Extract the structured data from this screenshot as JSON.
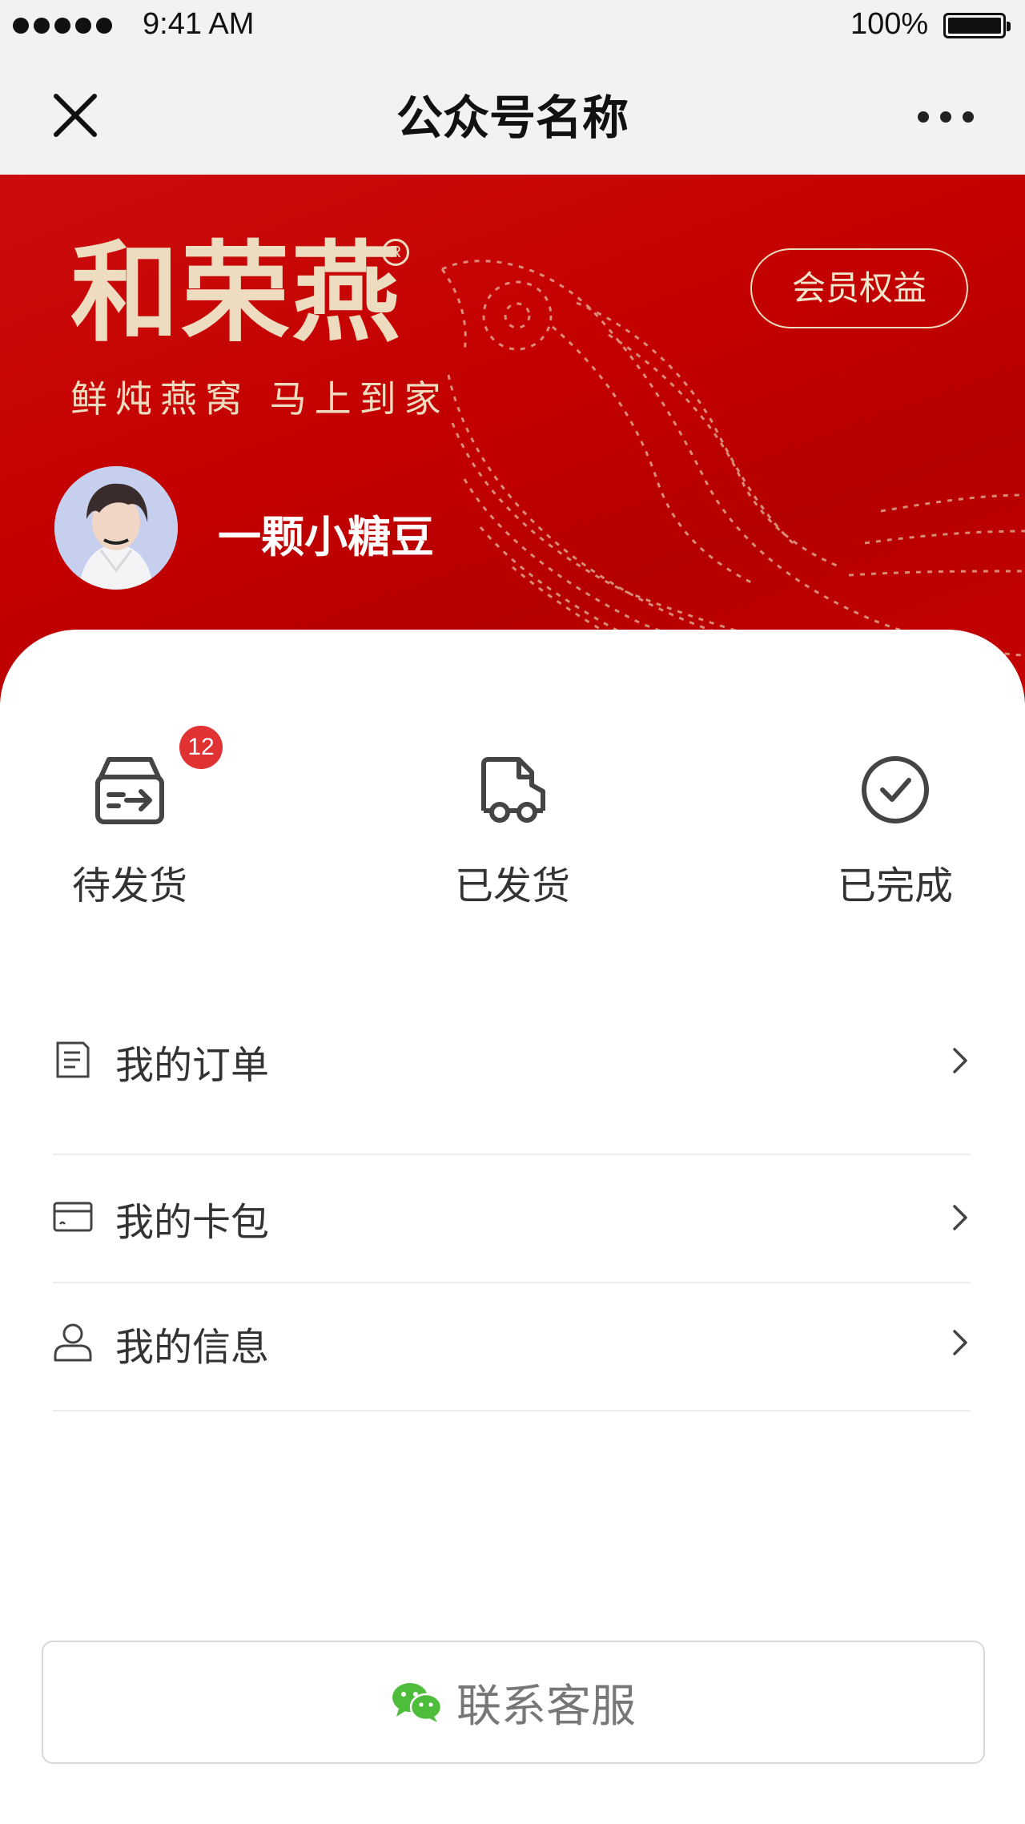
{
  "status_bar": {
    "time": "9:41 AM",
    "battery": "100%",
    "signal_bars": 5
  },
  "nav": {
    "title": "公众号名称",
    "close_icon": "close-icon",
    "more_icon": "more-icon"
  },
  "hero": {
    "brand_logo": "和荣燕",
    "brand_reg": "R",
    "brand_slogan": "鲜炖燕窝  马上到家",
    "member_button": "会员权益",
    "username": "一颗小糖豆",
    "background_color": "#c40000",
    "accent_color": "#eedcc0"
  },
  "order_status": {
    "items": [
      {
        "label": "待发货",
        "icon": "box-send-icon",
        "badge": "12"
      },
      {
        "label": "已发货",
        "icon": "truck-icon"
      },
      {
        "label": "已完成",
        "icon": "check-circle-icon"
      }
    ],
    "badge_color": "#e03232"
  },
  "menu": {
    "items": [
      {
        "label": "我的订单",
        "icon": "document-icon"
      },
      {
        "label": "我的卡包",
        "icon": "card-icon"
      },
      {
        "label": "我的信息",
        "icon": "user-icon"
      }
    ]
  },
  "customer_service": {
    "label": "联系客服",
    "icon": "wechat-icon",
    "icon_color": "#4fbd3c"
  }
}
